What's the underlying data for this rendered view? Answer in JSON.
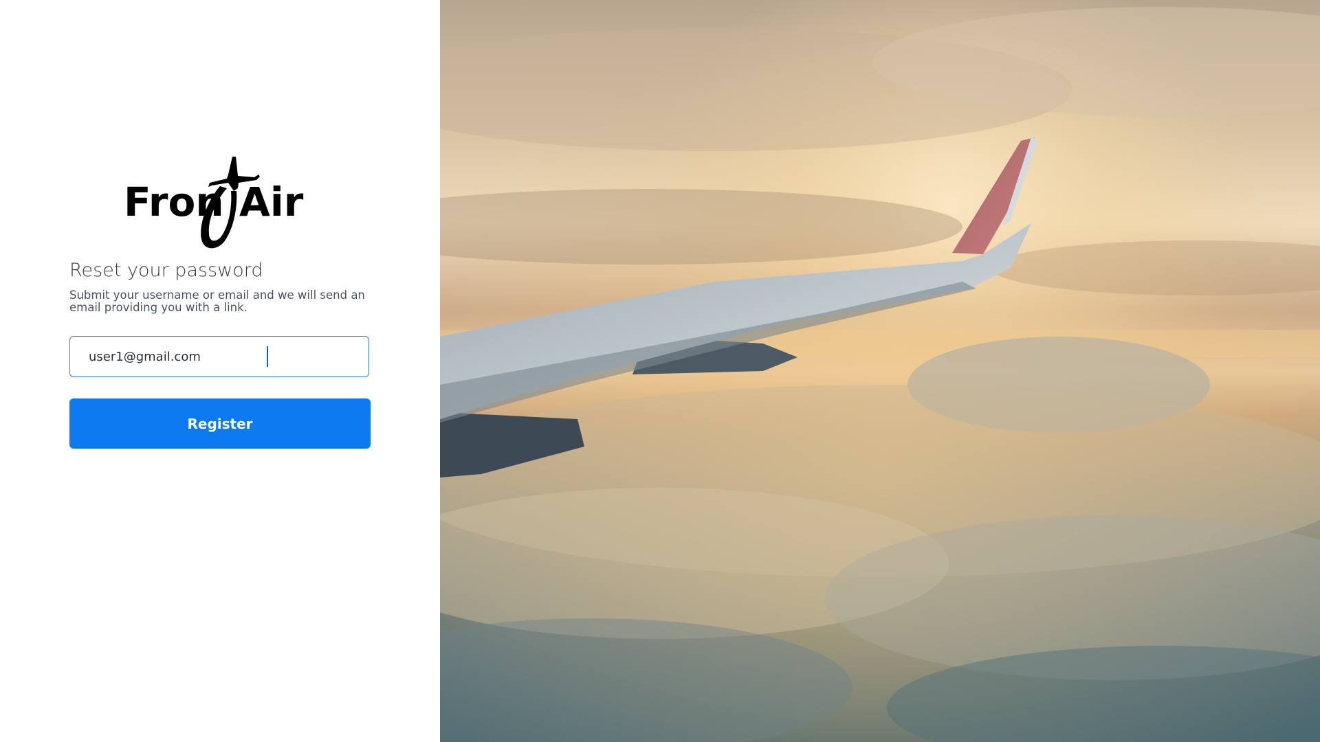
{
  "brand": {
    "name": "FrontAir",
    "logo_icon": "airplane-icon"
  },
  "reset_form": {
    "title": "Reset your password",
    "subtitle": "Submit your username or email and we will send an email providing you with a link.",
    "email_value": "user1@gmail.com",
    "submit_label": "Register"
  },
  "hero_image": {
    "subject": "airplane-wing-over-clouds"
  },
  "colors": {
    "primary": "#0d7af0",
    "input_border": "#2e7fd6"
  }
}
